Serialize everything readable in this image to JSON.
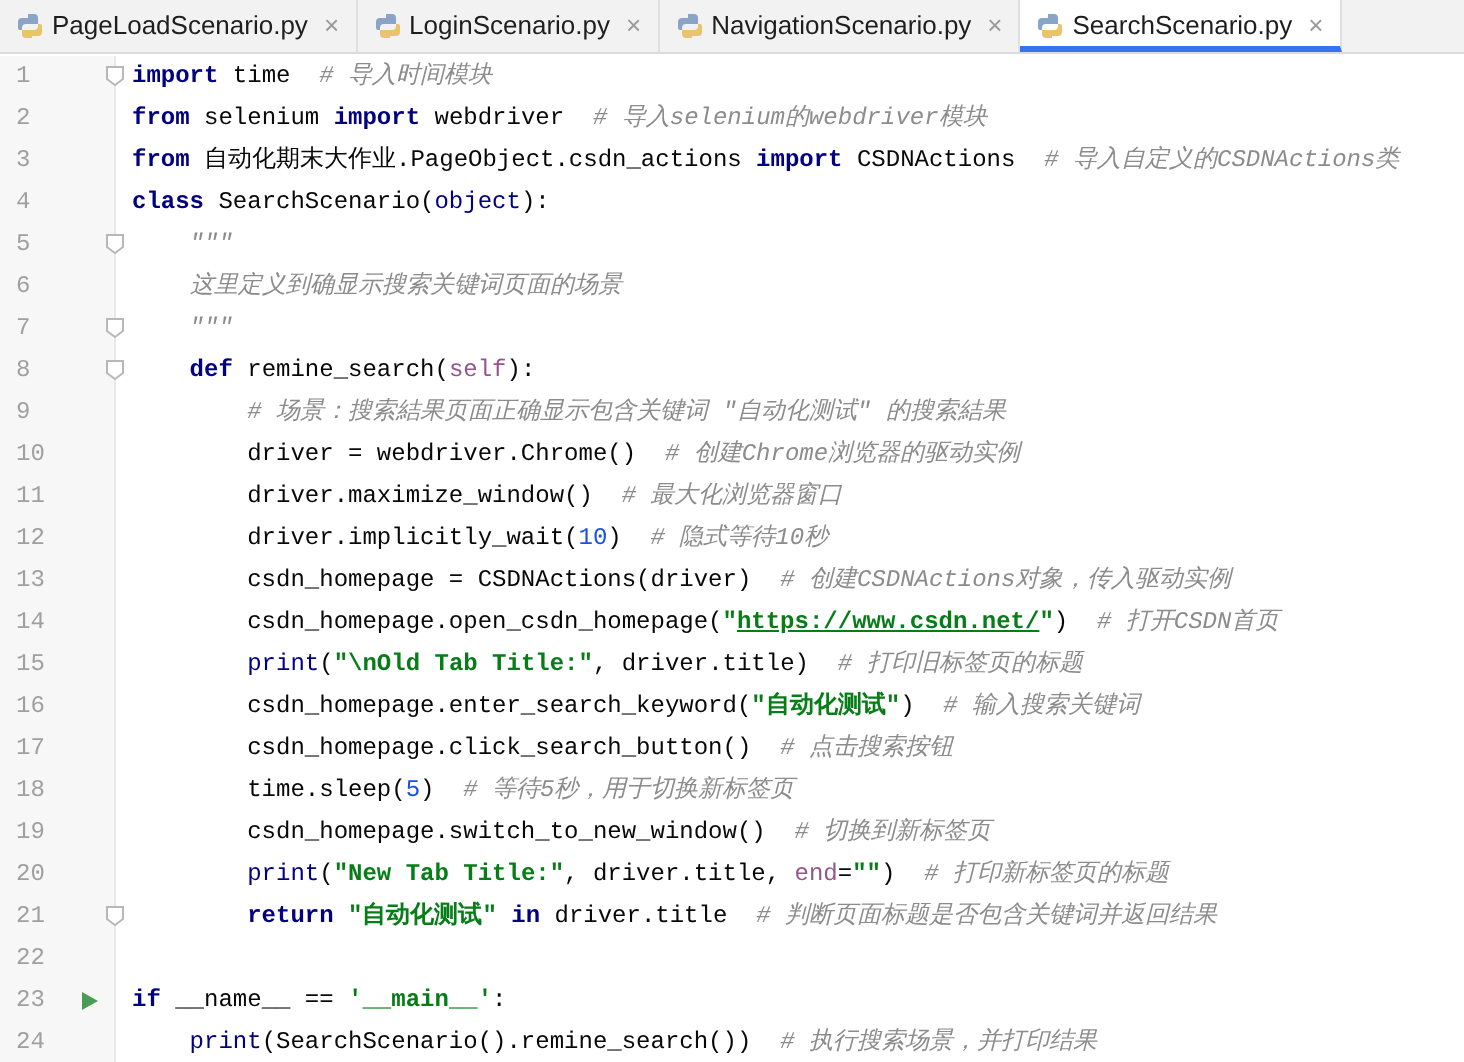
{
  "tabs": [
    {
      "label": "PageLoadScenario.py",
      "close": "×",
      "selected": false
    },
    {
      "label": "LoginScenario.py",
      "close": "×",
      "selected": false
    },
    {
      "label": "NavigationScenario.py",
      "close": "×",
      "selected": false
    },
    {
      "label": "SearchScenario.py",
      "close": "×",
      "selected": true
    }
  ],
  "lines": [
    {
      "number": "1",
      "fold": true,
      "run": false,
      "tokens": [
        {
          "kind": "kw",
          "text": "import"
        },
        {
          "kind": "plain",
          "text": " time  "
        },
        {
          "kind": "comment",
          "text": "# 导入时间模块"
        }
      ]
    },
    {
      "number": "2",
      "fold": false,
      "run": false,
      "tokens": [
        {
          "kind": "kw",
          "text": "from"
        },
        {
          "kind": "plain",
          "text": " selenium "
        },
        {
          "kind": "kw",
          "text": "import"
        },
        {
          "kind": "plain",
          "text": " webdriver  "
        },
        {
          "kind": "comment",
          "text": "# 导入selenium的webdriver模块"
        }
      ]
    },
    {
      "number": "3",
      "fold": false,
      "run": false,
      "tokens": [
        {
          "kind": "kw",
          "text": "from"
        },
        {
          "kind": "plain",
          "text": " 自动化期末大作业.PageObject.csdn_actions "
        },
        {
          "kind": "kw",
          "text": "import"
        },
        {
          "kind": "plain",
          "text": " CSDNActions  "
        },
        {
          "kind": "comment",
          "text": "# 导入自定义的CSDNActions类"
        }
      ]
    },
    {
      "number": "4",
      "fold": false,
      "run": false,
      "tokens": [
        {
          "kind": "kw",
          "text": "class"
        },
        {
          "kind": "plain",
          "text": " SearchScenario("
        },
        {
          "kind": "builtin",
          "text": "object"
        },
        {
          "kind": "plain",
          "text": "):"
        }
      ]
    },
    {
      "number": "5",
      "fold": true,
      "run": false,
      "tokens": [
        {
          "kind": "comment",
          "text": "    \"\"\""
        }
      ]
    },
    {
      "number": "6",
      "fold": false,
      "run": false,
      "tokens": [
        {
          "kind": "comment",
          "text": "    这里定义到确显示搜索关键词页面的场景"
        }
      ]
    },
    {
      "number": "7",
      "fold": true,
      "run": false,
      "tokens": [
        {
          "kind": "comment",
          "text": "    \"\"\""
        }
      ]
    },
    {
      "number": "8",
      "fold": true,
      "run": false,
      "tokens": [
        {
          "kind": "kw",
          "text": "    def"
        },
        {
          "kind": "plain",
          "text": " remine_search("
        },
        {
          "kind": "self",
          "text": "self"
        },
        {
          "kind": "plain",
          "text": "):"
        }
      ]
    },
    {
      "number": "9",
      "fold": false,
      "run": false,
      "tokens": [
        {
          "kind": "comment",
          "text": "        # 场景：搜索結果页面正确显示包含关键词 \"自动化测试\" 的搜索結果"
        }
      ]
    },
    {
      "number": "10",
      "fold": false,
      "run": false,
      "tokens": [
        {
          "kind": "plain",
          "text": "        driver = webdriver.Chrome()  "
        },
        {
          "kind": "comment",
          "text": "# 创建Chrome浏览器的驱动实例"
        }
      ]
    },
    {
      "number": "11",
      "fold": false,
      "run": false,
      "tokens": [
        {
          "kind": "plain",
          "text": "        driver.maximize_window()  "
        },
        {
          "kind": "comment",
          "text": "# 最大化浏览器窗口"
        }
      ]
    },
    {
      "number": "12",
      "fold": false,
      "run": false,
      "tokens": [
        {
          "kind": "plain",
          "text": "        driver.implicitly_wait("
        },
        {
          "kind": "num",
          "text": "10"
        },
        {
          "kind": "plain",
          "text": ")  "
        },
        {
          "kind": "comment",
          "text": "# 隐式等待10秒"
        }
      ]
    },
    {
      "number": "13",
      "fold": false,
      "run": false,
      "tokens": [
        {
          "kind": "plain",
          "text": "        csdn_homepage = CSDNActions(driver)  "
        },
        {
          "kind": "comment",
          "text": "# 创建CSDNActions对象，传入驱动实例"
        }
      ]
    },
    {
      "number": "14",
      "fold": false,
      "run": false,
      "tokens": [
        {
          "kind": "plain",
          "text": "        csdn_homepage.open_csdn_homepage("
        },
        {
          "kind": "str",
          "text": "\""
        },
        {
          "kind": "link",
          "text": "https://www.csdn.net/"
        },
        {
          "kind": "str",
          "text": "\""
        },
        {
          "kind": "plain",
          "text": ")  "
        },
        {
          "kind": "comment",
          "text": "# 打开CSDN首页"
        }
      ]
    },
    {
      "number": "15",
      "fold": false,
      "run": false,
      "tokens": [
        {
          "kind": "builtin",
          "text": "        print"
        },
        {
          "kind": "plain",
          "text": "("
        },
        {
          "kind": "str",
          "text": "\"\\nOld Tab Title:\""
        },
        {
          "kind": "plain",
          "text": ", driver.title)  "
        },
        {
          "kind": "comment",
          "text": "# 打印旧标签页的标题"
        }
      ]
    },
    {
      "number": "16",
      "fold": false,
      "run": false,
      "tokens": [
        {
          "kind": "plain",
          "text": "        csdn_homepage.enter_search_keyword("
        },
        {
          "kind": "str",
          "text": "\"自动化测试\""
        },
        {
          "kind": "plain",
          "text": ")  "
        },
        {
          "kind": "comment",
          "text": "# 输入搜索关键词"
        }
      ]
    },
    {
      "number": "17",
      "fold": false,
      "run": false,
      "tokens": [
        {
          "kind": "plain",
          "text": "        csdn_homepage.click_search_button()  "
        },
        {
          "kind": "comment",
          "text": "# 点击搜索按钮"
        }
      ]
    },
    {
      "number": "18",
      "fold": false,
      "run": false,
      "tokens": [
        {
          "kind": "plain",
          "text": "        time.sleep("
        },
        {
          "kind": "num",
          "text": "5"
        },
        {
          "kind": "plain",
          "text": ")  "
        },
        {
          "kind": "comment",
          "text": "# 等待5秒，用于切换新标签页"
        }
      ]
    },
    {
      "number": "19",
      "fold": false,
      "run": false,
      "tokens": [
        {
          "kind": "plain",
          "text": "        csdn_homepage.switch_to_new_window()  "
        },
        {
          "kind": "comment",
          "text": "# 切换到新标签页"
        }
      ]
    },
    {
      "number": "20",
      "fold": false,
      "run": false,
      "tokens": [
        {
          "kind": "builtin",
          "text": "        print"
        },
        {
          "kind": "plain",
          "text": "("
        },
        {
          "kind": "str",
          "text": "\"New Tab Title:\""
        },
        {
          "kind": "plain",
          "text": ", driver.title, "
        },
        {
          "kind": "self",
          "text": "end"
        },
        {
          "kind": "plain",
          "text": "="
        },
        {
          "kind": "str",
          "text": "\"\""
        },
        {
          "kind": "plain",
          "text": ")  "
        },
        {
          "kind": "comment",
          "text": "# 打印新标签页的标题"
        }
      ]
    },
    {
      "number": "21",
      "fold": true,
      "run": false,
      "tokens": [
        {
          "kind": "kw",
          "text": "        return"
        },
        {
          "kind": "str",
          "text": " \"自动化测试\" "
        },
        {
          "kind": "kw",
          "text": "in"
        },
        {
          "kind": "plain",
          "text": " driver.title  "
        },
        {
          "kind": "comment",
          "text": "# 判断页面标题是否包含关键词并返回结果"
        }
      ]
    },
    {
      "number": "22",
      "fold": false,
      "run": false
    },
    {
      "number": "23",
      "fold": false,
      "run": true,
      "tokens": [
        {
          "kind": "kw",
          "text": "if"
        },
        {
          "kind": "plain",
          "text": " __name__ == "
        },
        {
          "kind": "str",
          "text": "'__main__'"
        },
        {
          "kind": "plain",
          "text": ":"
        }
      ]
    },
    {
      "number": "24",
      "fold": false,
      "run": false,
      "tokens": [
        {
          "kind": "builtin",
          "text": "    print"
        },
        {
          "kind": "plain",
          "text": "(SearchScenario().remine_search())  "
        },
        {
          "kind": "comment",
          "text": "# 执行搜索场景，并打印结果"
        }
      ]
    }
  ]
}
